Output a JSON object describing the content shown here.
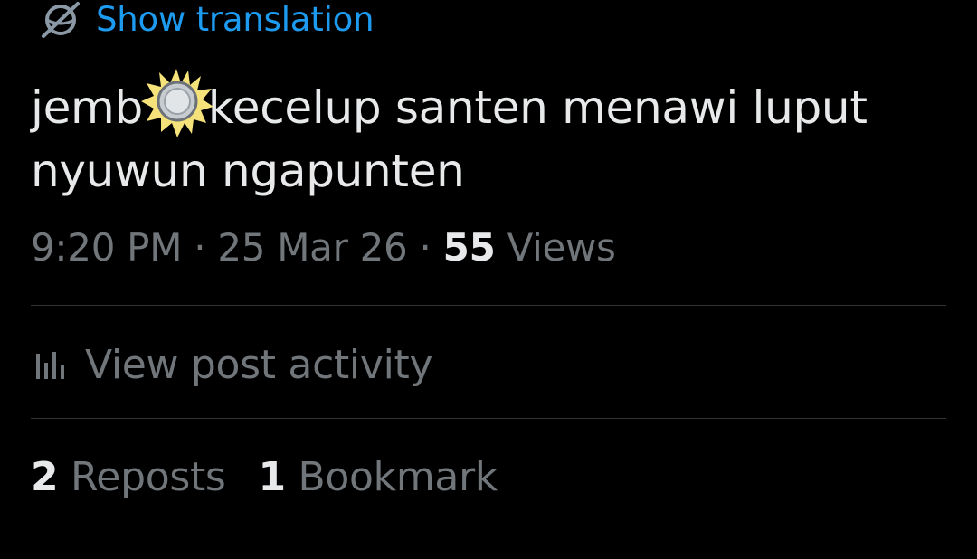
{
  "translation": {
    "icon": "translate-globe-slash-icon",
    "label": "Show translation"
  },
  "post": {
    "text_line1_before_emoji": "jemb",
    "emoji": "coin-splash-emoji",
    "text_line1_after_emoji": "kecelup santen menawi luput",
    "text_line2": "nyuwun ngapunten"
  },
  "meta": {
    "time": "9:20 PM",
    "separator": "·",
    "date": "25 Mar 26",
    "views_count": "55",
    "views_label": "Views"
  },
  "activity": {
    "icon": "bar-chart-icon",
    "label": "View post activity"
  },
  "stats": {
    "reposts_count": "2",
    "reposts_label": "Reposts",
    "bookmarks_count": "1",
    "bookmarks_label": "Bookmark"
  },
  "colors": {
    "background": "#000000",
    "text_primary": "#e7e9ea",
    "text_secondary": "#71767b",
    "accent_link": "#1d9bf0",
    "divider": "#2f3336"
  }
}
